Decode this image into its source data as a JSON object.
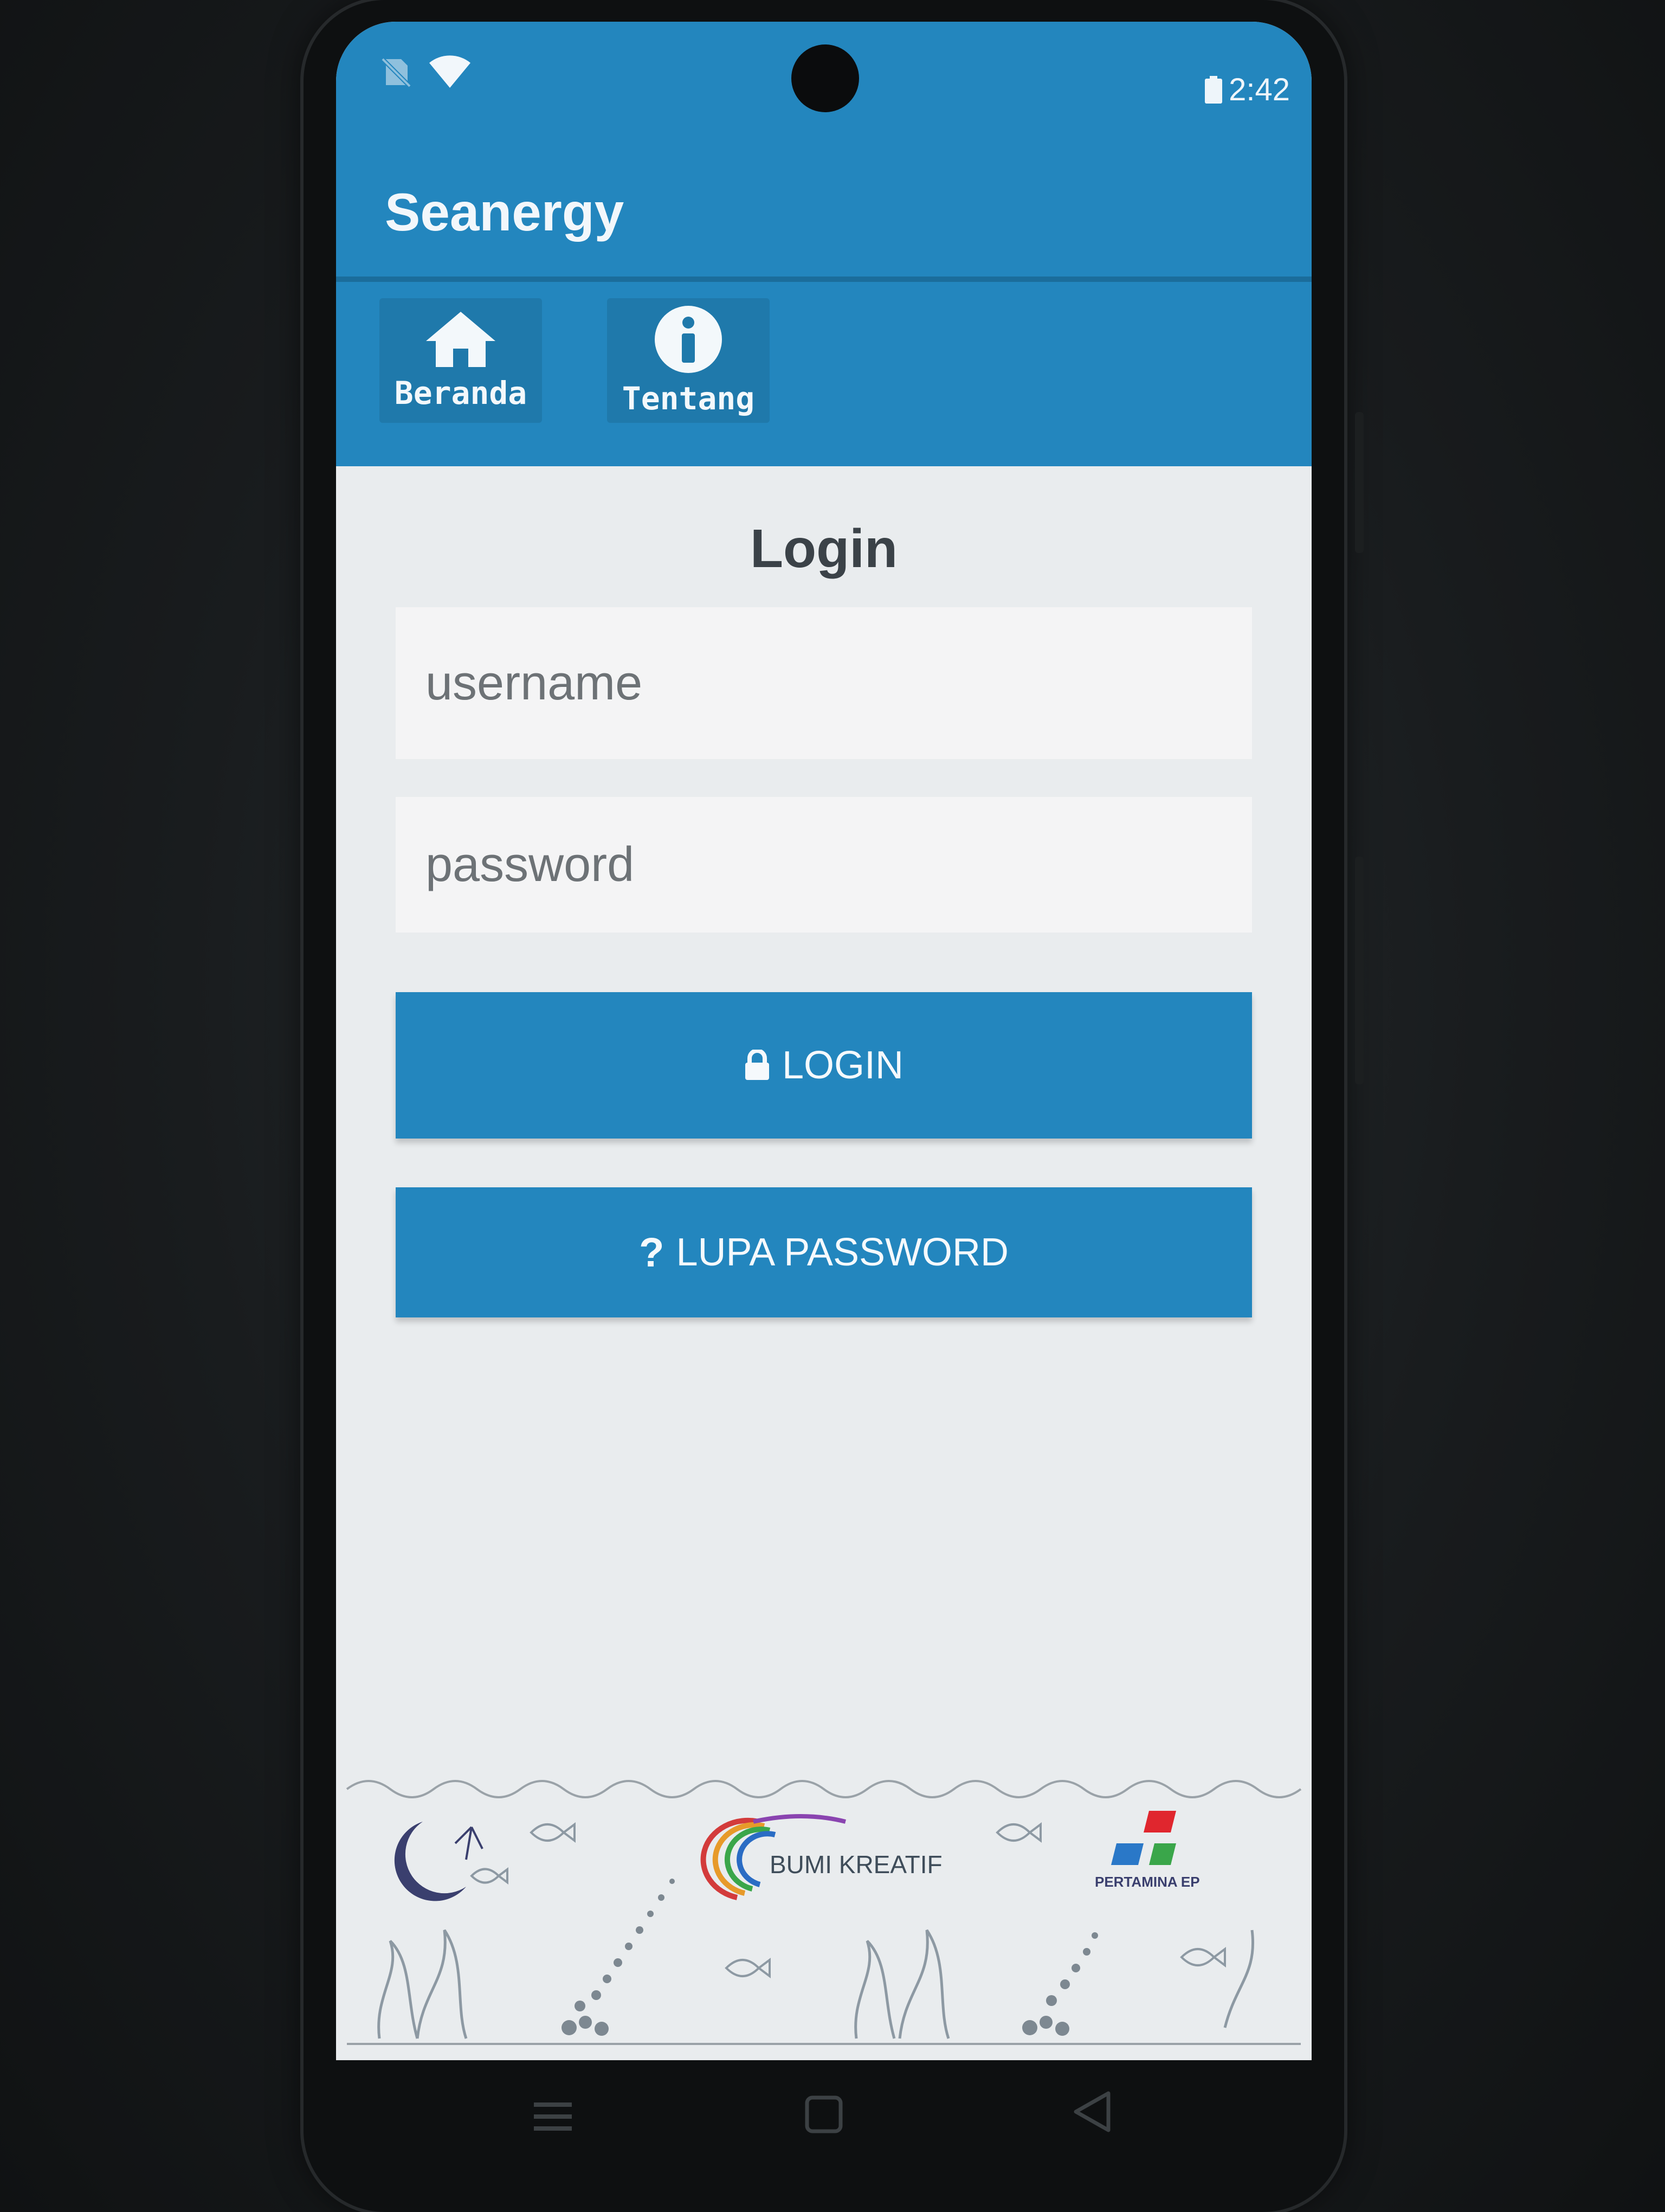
{
  "status_bar": {
    "time": "2:42",
    "icons": [
      "no-sim-icon",
      "wifi-icon",
      "battery-icon"
    ]
  },
  "app_bar": {
    "title": "Seanergy"
  },
  "nav": {
    "items": [
      {
        "label": "Beranda",
        "icon": "home-icon"
      },
      {
        "label": "Tentang",
        "icon": "info-icon"
      }
    ]
  },
  "login": {
    "title": "Login",
    "username_placeholder": "username",
    "password_placeholder": "password",
    "login_button": "LOGIN",
    "forgot_button": "LUPA PASSWORD"
  },
  "footer": {
    "logos": [
      "seanergy-logo",
      "bumi-kreatif-logo",
      "pertamina-ep-logo"
    ],
    "bumi_kreatif_text": "BUMI KREATIF",
    "pertamina_text": "PERTAMINA EP"
  },
  "hardware_nav": [
    "menu-icon",
    "home-square-icon",
    "back-triangle-icon"
  ],
  "colors": {
    "primary": "#2386be",
    "background": "#e9ecee",
    "title_text": "#3b4248"
  }
}
